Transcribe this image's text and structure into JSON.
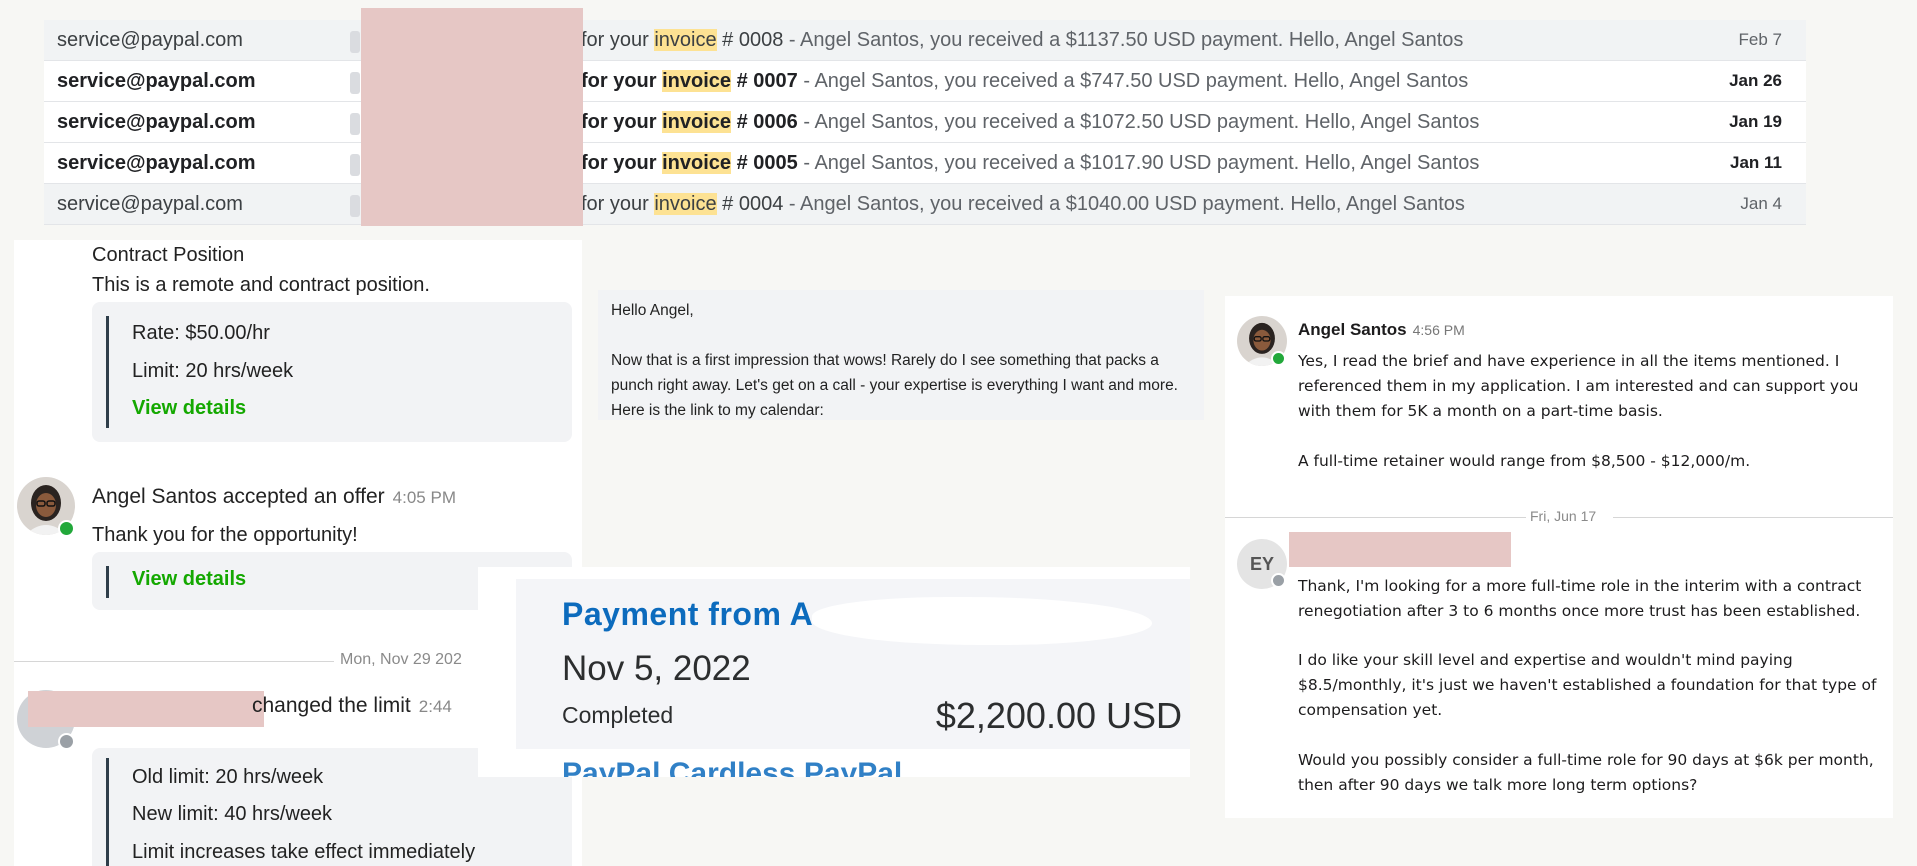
{
  "emails": [
    {
      "sender": "service@paypal.com",
      "subject_pre": "for your ",
      "highlight": "invoice",
      "subject_post": " # 0008",
      "snippet": " - Angel Santos, you received a $1137.50 USD payment. Hello, Angel Santos",
      "date": "Feb 7",
      "unread": false
    },
    {
      "sender": "service@paypal.com",
      "subject_pre": "for your ",
      "highlight": "invoice",
      "subject_post": " # 0007",
      "snippet": " - Angel Santos, you received a $747.50 USD payment. Hello, Angel Santos",
      "date": "Jan 26",
      "unread": true
    },
    {
      "sender": "service@paypal.com",
      "subject_pre": "for your ",
      "highlight": "invoice",
      "subject_post": " # 0006",
      "snippet": " - Angel Santos, you received a $1072.50 USD payment. Hello, Angel Santos",
      "date": "Jan 19",
      "unread": true
    },
    {
      "sender": "service@paypal.com",
      "subject_pre": "for your ",
      "highlight": "invoice",
      "subject_post": " # 0005",
      "snippet": " - Angel Santos, you received a $1017.90 USD payment. Hello, Angel Santos",
      "date": "Jan 11",
      "unread": true
    },
    {
      "sender": "service@paypal.com",
      "subject_pre": "for your ",
      "highlight": "invoice",
      "subject_post": " # 0004",
      "snippet": " - Angel Santos, you received a $1040.00 USD payment. Hello, Angel Santos",
      "date": "Jan 4",
      "unread": false
    }
  ],
  "contract": {
    "heading": "Contract Position",
    "description": "This is a remote and contract position.",
    "rate": "Rate: $50.00/hr",
    "limit": "Limit: 20 hrs/week",
    "view_details": "View details"
  },
  "offer_message": {
    "header": "Angel Santos accepted an offer",
    "time": "4:05 PM",
    "body": "Thank you for the opportunity!",
    "view_details": "View details"
  },
  "date_separator": "Mon, Nov 29 202",
  "limit_message": {
    "header": "changed the limit",
    "time": "2:44",
    "old_limit": "Old limit: 20 hrs/week",
    "new_limit": "New limit: 40 hrs/week",
    "note": "Limit increases take effect immediately"
  },
  "angel_email": {
    "greeting": "Hello Angel,",
    "body": "Now that is a first impression that wows! Rarely do I see something that packs a punch right away. Let's get on a call - your expertise is everything I want and more. Here is the link to my calendar:"
  },
  "payment": {
    "title": "Payment from A",
    "date": "Nov 5, 2022",
    "status": "Completed",
    "amount": "$2,200.00 USD",
    "footer_partial": "PayPal Cardless PayPal"
  },
  "chat": {
    "sender1": {
      "name": "Angel Santos",
      "time": "4:56 PM"
    },
    "msg1_p1": "Yes, I read the brief and have experience in all the items mentioned. I referenced them in my application. I am interested and can support you with them for 5K a month on a part-time basis.",
    "msg1_p2": "A full-time retainer would range from $8,500 - $12,000/m.",
    "date_separator": "Fri, Jun 17",
    "sender2_initials": "EY",
    "msg2_p1": "Thank, I'm looking for a more full-time role in the interim with a contract renegotiation after 3 to 6 months once more trust has been established.",
    "msg2_p2": "I do like your skill level and expertise and wouldn't mind paying $8.5/monthly, it's just we haven't established a foundation for that type of compensation yet.",
    "msg2_p3": "Would you possibly consider a full-time role for 90 days at $6k per month, then after 90 days we talk more long term options?"
  },
  "colors": {
    "upwork_green": "#14a800",
    "paypal_blue": "#0c6bbd",
    "invoice_highlight": "#fde293",
    "redaction": "#e6c7c5",
    "online_dot": "#22a83a"
  }
}
